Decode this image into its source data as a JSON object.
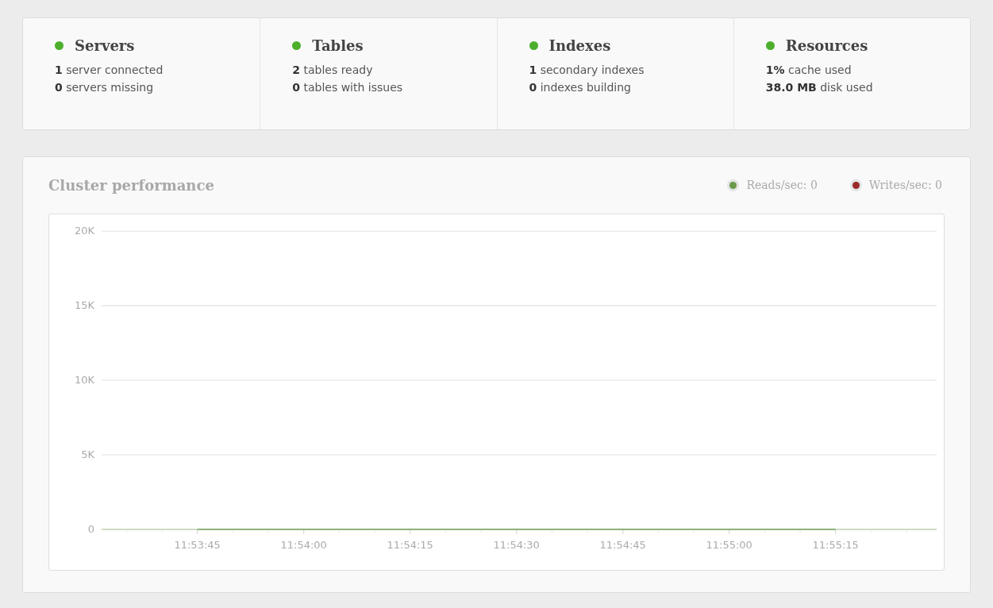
{
  "status_cards": [
    {
      "title": "Servers",
      "color": "#4caf2c",
      "lines": [
        "**1** server connected",
        "**0** servers missing"
      ]
    },
    {
      "title": "Tables",
      "color": "#4caf2c",
      "lines": [
        "**2** tables ready",
        "**0** tables with issues"
      ]
    },
    {
      "title": "Indexes",
      "color": "#4caf2c",
      "lines": [
        "**1** secondary indexes",
        "**0** indexes building"
      ]
    },
    {
      "title": "Resources",
      "color": "#4caf2c",
      "lines": [
        "**1%** cache used",
        "**38.0 MB** disk used"
      ]
    }
  ],
  "performance": {
    "title": "Cluster performance",
    "chart_data": {
      "type": "line",
      "categories": [
        "11:53:45",
        "11:54:00",
        "11:54:15",
        "11:54:30",
        "11:54:45",
        "11:55:00",
        "11:55:15"
      ],
      "series": [
        {
          "name": "Reads/sec: 0",
          "color": "#6a9a4a",
          "values": [
            0,
            0,
            0,
            0,
            0,
            0,
            0
          ]
        },
        {
          "name": "Writes/sec: 0",
          "color": "#9a2a2a",
          "values": [
            null,
            null,
            null,
            null,
            null,
            null,
            null
          ]
        }
      ],
      "ylim": [
        0,
        20000
      ],
      "grid": true,
      "yticks": [
        {
          "value": 0,
          "label": "0"
        },
        {
          "value": 5000,
          "label": "5K"
        },
        {
          "value": 10000,
          "label": "10K"
        },
        {
          "value": 15000,
          "label": "15K"
        },
        {
          "value": 20000,
          "label": "20K"
        }
      ]
    }
  }
}
